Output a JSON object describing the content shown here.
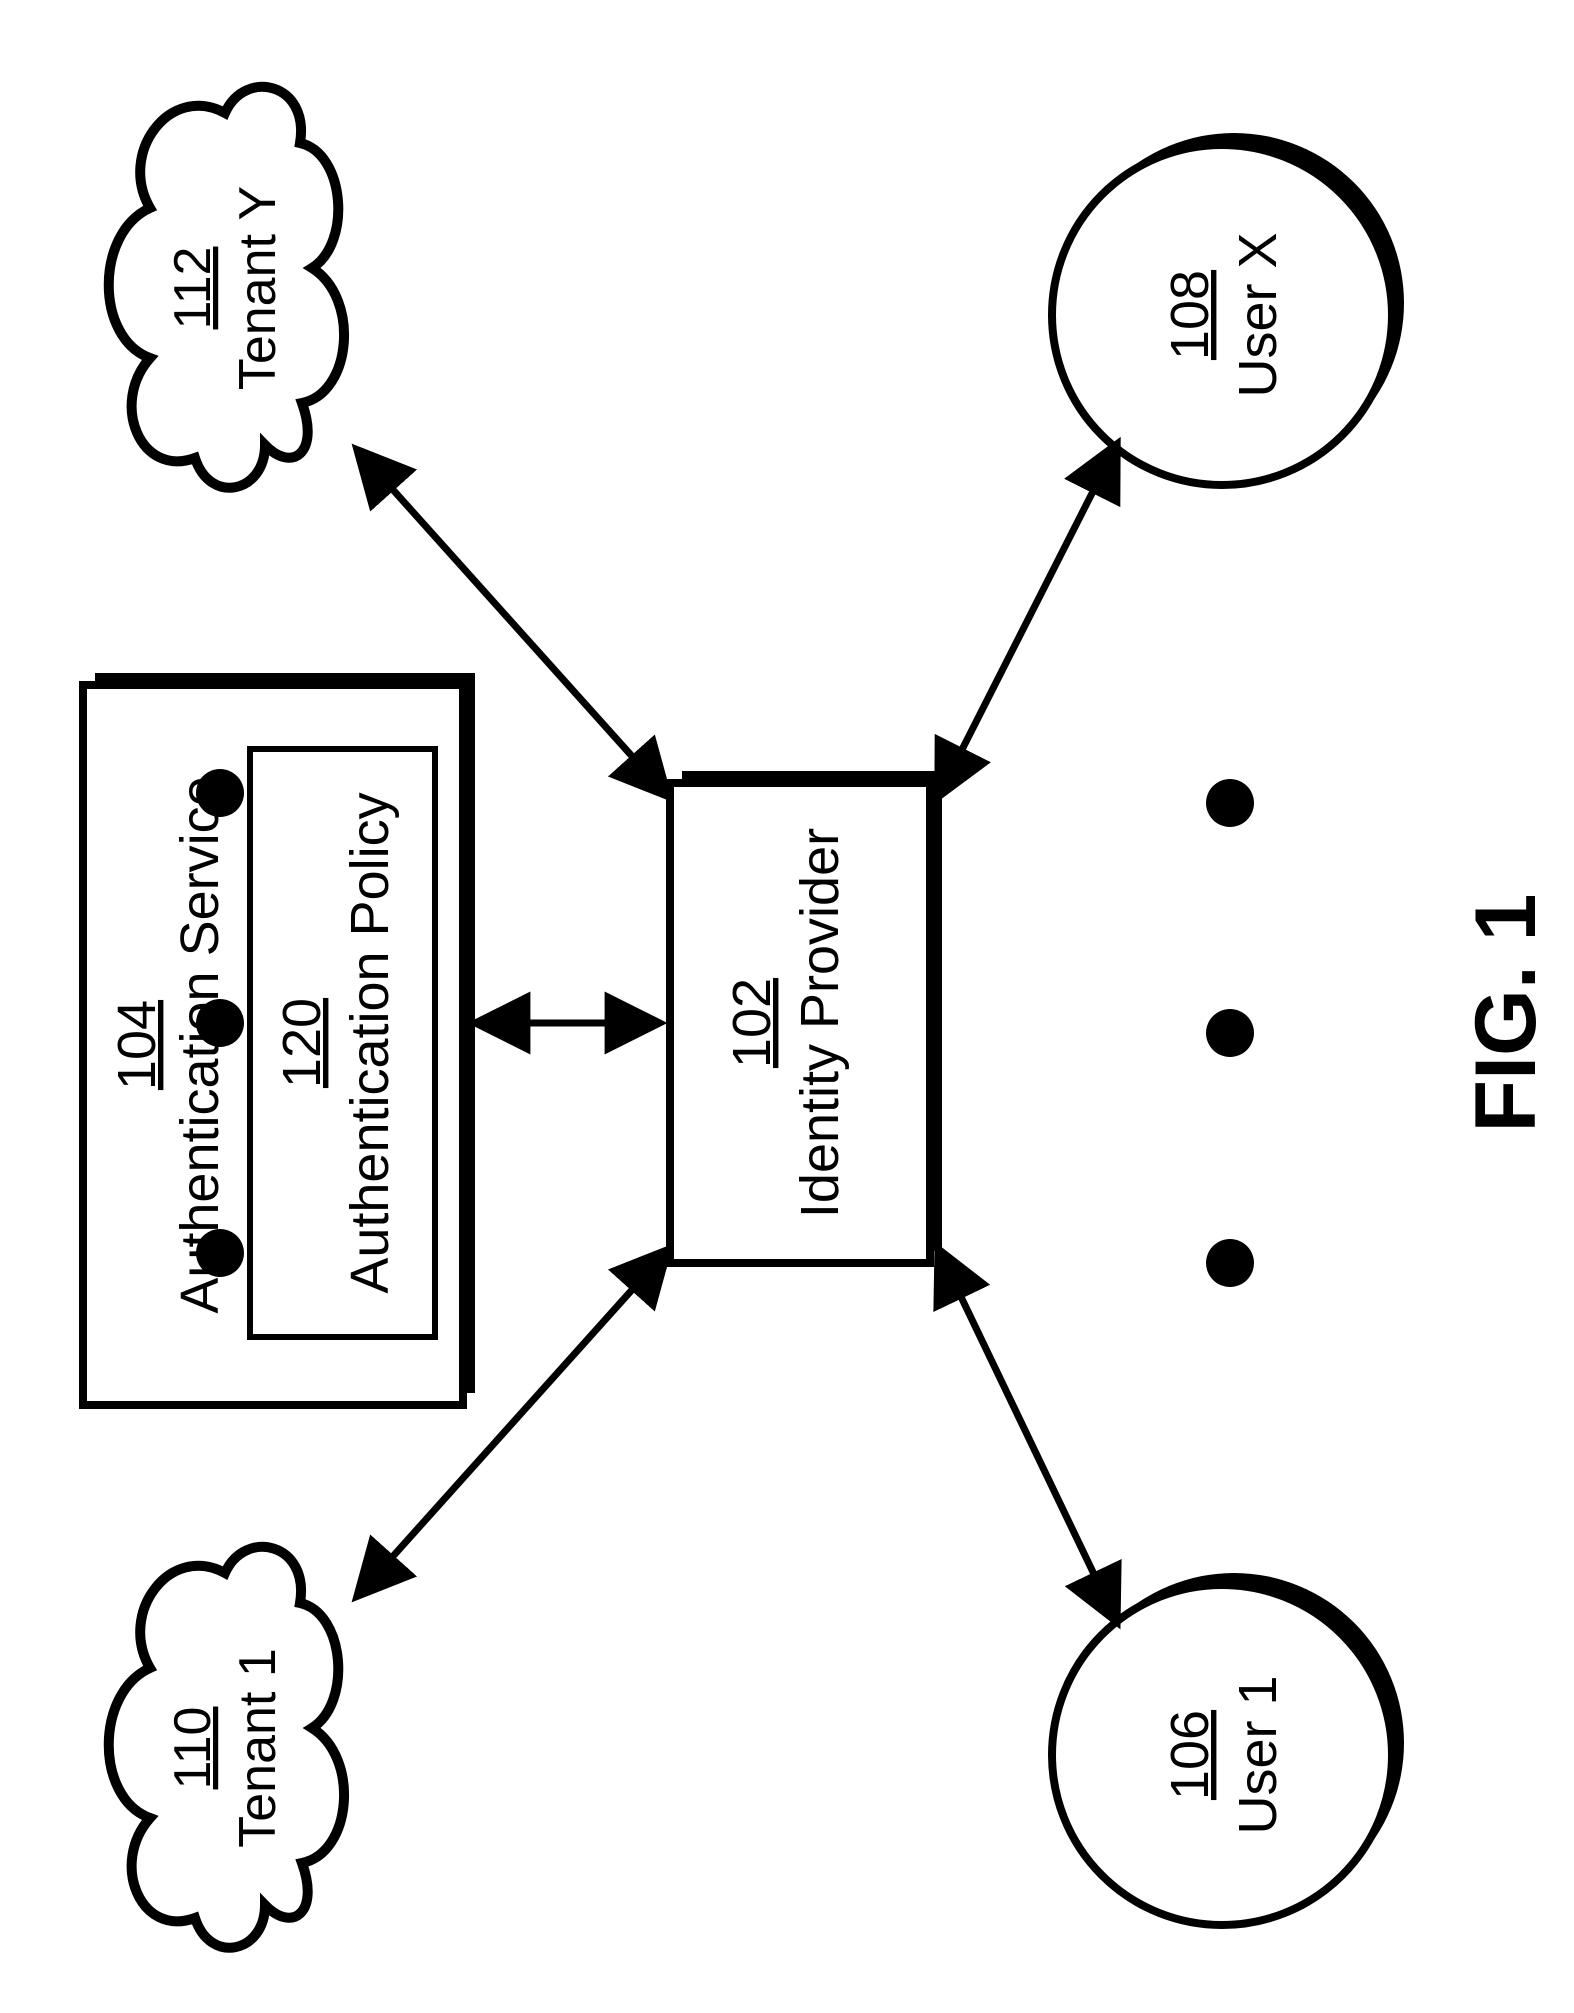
{
  "figure_label": "FIG. 1",
  "nodes": {
    "identity_provider": {
      "ref": "102",
      "label": "Identity Provider"
    },
    "authentication_service": {
      "ref": "104",
      "label": "Authentication Service"
    },
    "authentication_policy": {
      "ref": "120",
      "label": "Authentication Policy"
    },
    "user1": {
      "ref": "106",
      "label": "User 1"
    },
    "userX": {
      "ref": "108",
      "label": "User X"
    },
    "tenant1": {
      "ref": "110",
      "label": "Tenant 1"
    },
    "tenantY": {
      "ref": "112",
      "label": "Tenant Y"
    }
  }
}
